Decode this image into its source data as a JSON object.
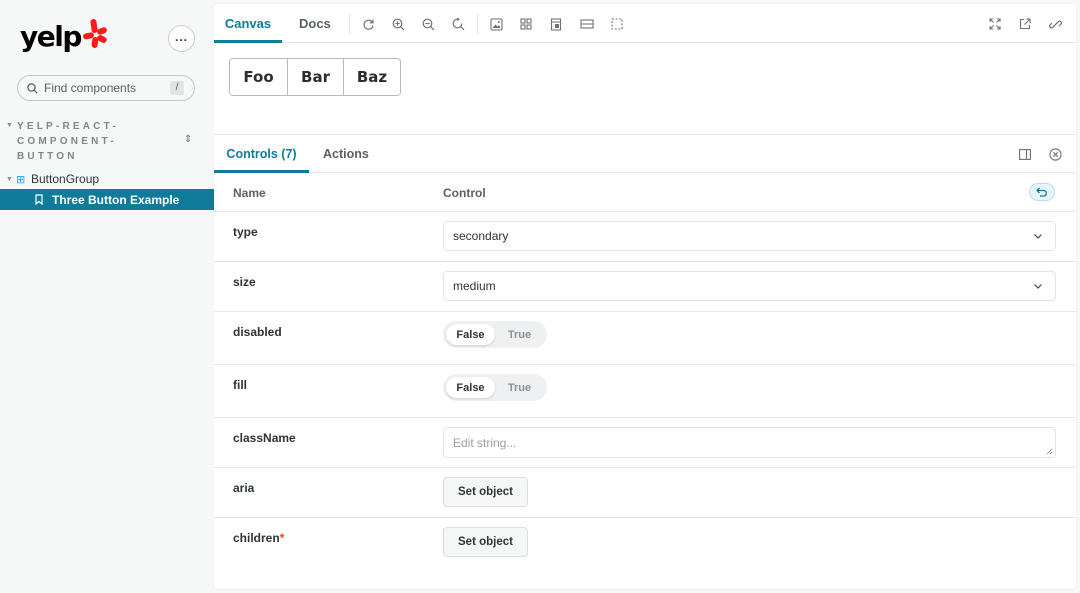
{
  "sidebar": {
    "logo_text": "yelp",
    "search_placeholder": "Find components",
    "search_shortcut": "/",
    "group_label": "YELP-REACT-COMPONENT-BUTTON",
    "component": "ButtonGroup",
    "story": "Three Button Example"
  },
  "toolbar": {
    "tabs": [
      "Canvas",
      "Docs"
    ]
  },
  "preview": {
    "buttons": [
      "Foo",
      "Bar",
      "Baz"
    ]
  },
  "addons": {
    "tabs": [
      "Controls (7)",
      "Actions"
    ],
    "headers": {
      "name": "Name",
      "control": "Control"
    },
    "rows": {
      "type": {
        "name": "type",
        "value": "secondary"
      },
      "size": {
        "name": "size",
        "value": "medium"
      },
      "disabled": {
        "name": "disabled",
        "on": "False",
        "off": "True"
      },
      "fill": {
        "name": "fill",
        "on": "False",
        "off": "True"
      },
      "className": {
        "name": "className",
        "placeholder": "Edit string..."
      },
      "aria": {
        "name": "aria",
        "button": "Set object"
      },
      "children": {
        "name": "children",
        "required_mark": "*",
        "button": "Set object"
      }
    }
  },
  "colors": {
    "accent": "#0f7b9a",
    "yelp_red": "#ff1a1a",
    "required": "#ff4400"
  }
}
